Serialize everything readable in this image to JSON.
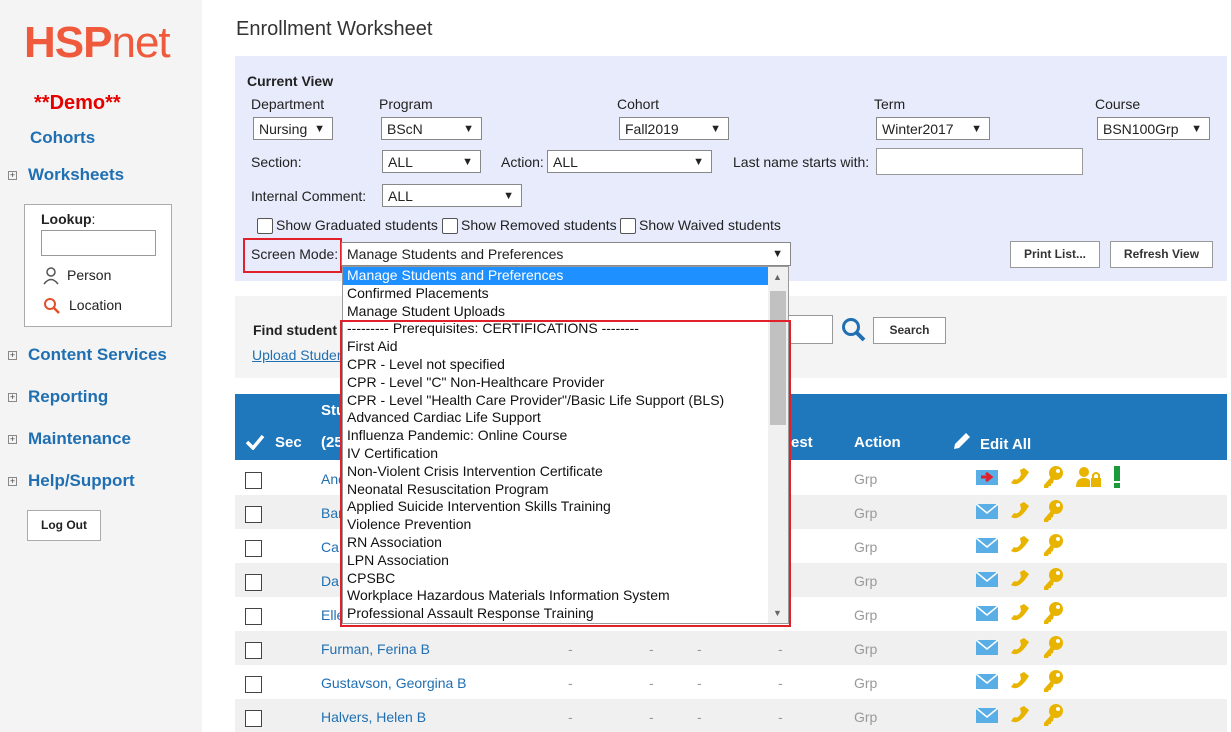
{
  "sidebar": {
    "logo_main": "HSP",
    "logo_suffix": "net",
    "demo": "**Demo**",
    "cohorts": "Cohorts",
    "worksheets": "Worksheets",
    "lookup": {
      "label": "Lookup",
      "colon": ":",
      "person": "Person",
      "location": "Location"
    },
    "content_services": "Content Services",
    "reporting": "Reporting",
    "maintenance": "Maintenance",
    "help": "Help/Support",
    "logout": "Log Out"
  },
  "page": {
    "title": "Enrollment Worksheet"
  },
  "view": {
    "heading": "Current View",
    "department": {
      "label": "Department",
      "value": "Nursing"
    },
    "program": {
      "label": "Program",
      "value": "BScN"
    },
    "cohort": {
      "label": "Cohort",
      "value": "Fall2019"
    },
    "term": {
      "label": "Term",
      "value": "Winter2017"
    },
    "course": {
      "label": "Course",
      "value": "BSN100Grp"
    },
    "section": {
      "label": "Section:",
      "value": "ALL"
    },
    "action": {
      "label": "Action:",
      "value": "ALL"
    },
    "lastname": {
      "label": "Last name starts with:",
      "value": ""
    },
    "internal": {
      "label": "Internal Comment:",
      "value": "ALL"
    },
    "show_graduated": "Show Graduated students",
    "show_removed": "Show Removed students",
    "show_waived": "Show Waived students",
    "screen_mode": {
      "label": "Screen Mode:",
      "value": "Manage Students and Preferences"
    },
    "print": "Print List...",
    "refresh": "Refresh View"
  },
  "find": {
    "label": "Find student f",
    "upload": "Upload Studen",
    "search": "Search"
  },
  "table": {
    "headers": {
      "sec": "Sec",
      "stu": "Stu",
      "count": "(25",
      "est": "est",
      "action": "Action",
      "edit_all": "Edit All"
    },
    "rows": [
      {
        "name": "And",
        "grp": "Grp"
      },
      {
        "name": "Bar",
        "grp": "Grp"
      },
      {
        "name": "Ca",
        "grp": "Grp"
      },
      {
        "name": "Da",
        "grp": "Grp"
      },
      {
        "name": "Elle",
        "grp": "Grp"
      },
      {
        "name": "Furman, Ferina B",
        "grp": "Grp",
        "d1": "-",
        "d2": "-",
        "d3": "-",
        "d4": "-"
      },
      {
        "name": "Gustavson, Georgina B",
        "grp": "Grp",
        "d1": "-",
        "d2": "-",
        "d3": "-",
        "d4": "-"
      },
      {
        "name": "Halvers, Helen B",
        "grp": "Grp",
        "d1": "-",
        "d2": "-",
        "d3": "-",
        "d4": "-"
      }
    ]
  },
  "dropdown": {
    "options": [
      "Manage Students and Preferences",
      "Confirmed Placements",
      "Manage Student Uploads",
      "--------- Prerequisites: CERTIFICATIONS --------",
      "First Aid",
      "CPR - Level not specified",
      "CPR - Level \"C\" Non-Healthcare Provider",
      "CPR - Level \"Health Care Provider\"/Basic Life Support (BLS)",
      "Advanced Cardiac Life Support",
      "Influenza Pandemic: Online Course",
      "IV Certification",
      "Non-Violent Crisis Intervention Certificate",
      "Neonatal Resuscitation Program",
      "Applied Suicide Intervention Skills Training",
      "Violence Prevention",
      "RN Association",
      "LPN Association",
      "CPSBC",
      "Workplace Hazardous Materials Information System",
      "Professional Assault Response Training"
    ]
  },
  "colors": {
    "accent": "#1f77bc",
    "panel": "#e7ebfb",
    "logo": "#ef5a3c",
    "highlight": "#e0202a",
    "icon_gold": "#e8b400",
    "icon_blue": "#5aaee6"
  }
}
